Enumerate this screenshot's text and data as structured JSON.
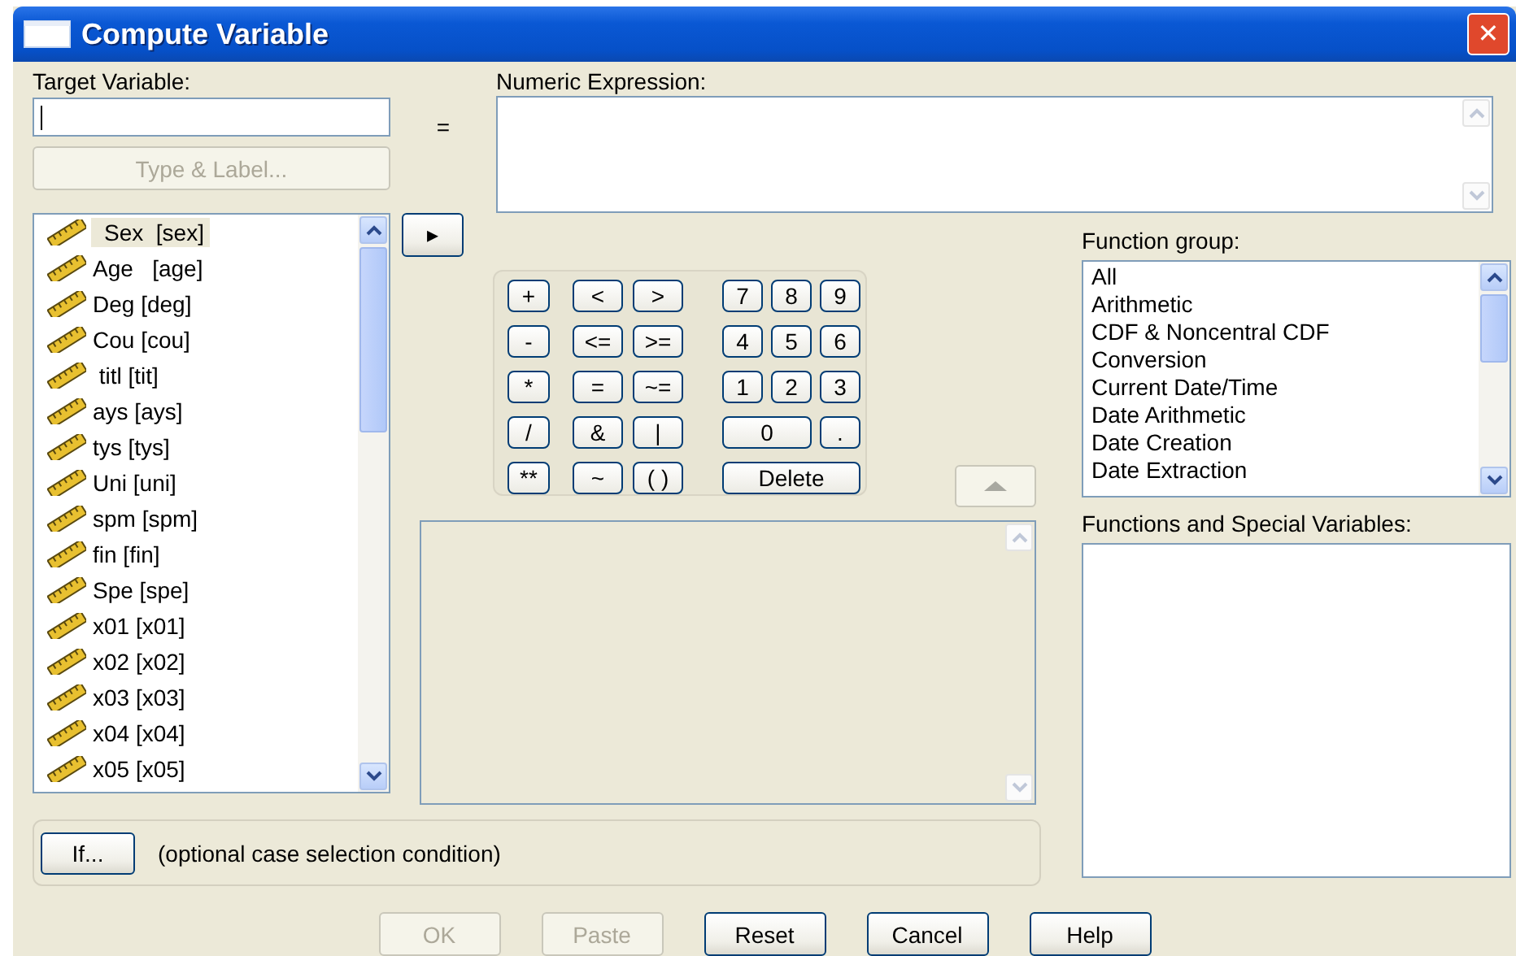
{
  "window": {
    "title": "Compute Variable",
    "close": "✕"
  },
  "target": {
    "label": "Target Variable:",
    "type_button": {
      "label": "Type & Label...",
      "disabled": true
    }
  },
  "equals": "=",
  "expression": {
    "label": "Numeric Expression:"
  },
  "move_button": "▸",
  "variables": [
    {
      "label": "Sex  [sex]",
      "selected": true
    },
    {
      "label": "Age   [age]",
      "selected": false
    },
    {
      "label": "Deg [deg]",
      "selected": false
    },
    {
      "label": "Cou [cou]",
      "selected": false
    },
    {
      "label": " titl [tit]",
      "selected": false
    },
    {
      "label": "ays [ays]",
      "selected": false
    },
    {
      "label": "tys [tys]",
      "selected": false
    },
    {
      "label": "Uni [uni]",
      "selected": false
    },
    {
      "label": "spm [spm]",
      "selected": false
    },
    {
      "label": "fin [fin]",
      "selected": false
    },
    {
      "label": "Spe [spe]",
      "selected": false
    },
    {
      "label": "x01 [x01]",
      "selected": false
    },
    {
      "label": "x02 [x02]",
      "selected": false
    },
    {
      "label": "x03 [x03]",
      "selected": false
    },
    {
      "label": "x04 [x04]",
      "selected": false
    },
    {
      "label": "x05 [x05]",
      "selected": false
    }
  ],
  "keypad": {
    "operators": [
      "+",
      "<",
      ">",
      "-",
      "<=",
      ">=",
      "*",
      "=",
      "~=",
      "/",
      "&",
      "|",
      "**",
      "~",
      "( )"
    ],
    "numbers": [
      {
        "label": "7",
        "kind": "key"
      },
      {
        "label": "8",
        "kind": "key"
      },
      {
        "label": "9",
        "kind": "key"
      },
      {
        "label": "4",
        "kind": "key"
      },
      {
        "label": "5",
        "kind": "key"
      },
      {
        "label": "6",
        "kind": "key"
      },
      {
        "label": "1",
        "kind": "key"
      },
      {
        "label": "2",
        "kind": "key"
      },
      {
        "label": "3",
        "kind": "key"
      },
      {
        "label": "0",
        "kind": "wide"
      },
      {
        "label": ".",
        "kind": "key"
      },
      {
        "label": "Delete",
        "kind": "full"
      }
    ]
  },
  "insert_button": {
    "disabled": true
  },
  "function_group": {
    "label": "Function group:",
    "items": [
      {
        "label": "All",
        "selected": false
      },
      {
        "label": "Arithmetic",
        "selected": false
      },
      {
        "label": "CDF & Noncentral CDF",
        "selected": false
      },
      {
        "label": "Conversion",
        "selected": false
      },
      {
        "label": "Current Date/Time",
        "selected": false
      },
      {
        "label": "Date Arithmetic",
        "selected": false
      },
      {
        "label": "Date Creation",
        "selected": false
      },
      {
        "label": "Date Extraction",
        "selected": false
      }
    ]
  },
  "functions": {
    "label": "Functions and Special Variables:"
  },
  "if_panel": {
    "button": "If...",
    "text": "(optional case selection condition)"
  },
  "buttons": [
    {
      "label": "OK",
      "disabled": true
    },
    {
      "label": "Paste",
      "disabled": true
    },
    {
      "label": "Reset",
      "disabled": false
    },
    {
      "label": "Cancel",
      "disabled": false
    },
    {
      "label": "Help",
      "disabled": false
    }
  ]
}
